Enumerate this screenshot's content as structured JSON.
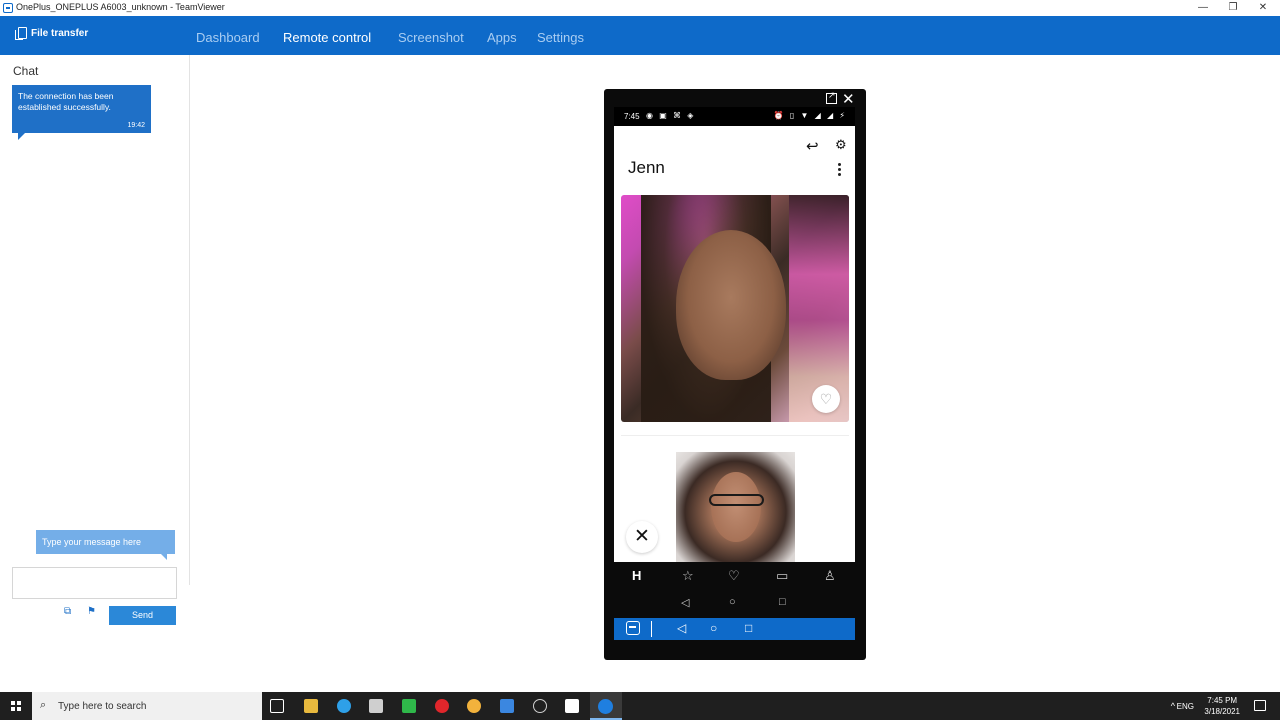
{
  "window": {
    "title": "OnePlus_ONEPLUS A6003_unknown - TeamViewer",
    "minimize_glyph": "—",
    "restore_glyph": "❐",
    "close_glyph": "✕"
  },
  "header": {
    "file_transfer_label": "File transfer",
    "tabs": [
      {
        "label": "Dashboard",
        "active": false
      },
      {
        "label": "Remote control",
        "active": true
      },
      {
        "label": "Screenshot",
        "active": false
      },
      {
        "label": "Apps",
        "active": false
      },
      {
        "label": "Settings",
        "active": false
      }
    ]
  },
  "chat": {
    "title": "Chat",
    "messages": [
      {
        "text": "The connection has been established successfully.",
        "time": "19:42"
      }
    ],
    "input_hint": "Type your message here",
    "input_value": "",
    "send_label": "Send"
  },
  "phone": {
    "status_time": "7:45",
    "status_icons_left": "◉ ▣ ⌘ ◈",
    "status_icons_right": "⏰ ▯ ▼ ◢ ◢ ⚡",
    "profile_name": "Jenn",
    "undo_glyph": "↩",
    "filter_glyph": "⚙",
    "like_glyph": "♡",
    "dismiss_glyph": "✕",
    "app_nav_icons": [
      "H",
      "☆",
      "♡",
      "▭",
      "♙"
    ],
    "system_nav": [
      "◁",
      "○",
      "□"
    ],
    "tv_nav": [
      "◁",
      "○",
      "□"
    ]
  },
  "taskbar": {
    "search_placeholder": "Type here to search",
    "language": "ENG",
    "time": "7:45 PM",
    "date": "3/18/2021",
    "app_icon_colors": [
      "#ffffff",
      "#e8b93e",
      "#2ea0e8",
      "#cfcfcf",
      "#2fb84a",
      "#e0262b",
      "#f2b23c",
      "#3b87e0",
      "#cfcfcf",
      "#ffffff",
      "#1f7fe0"
    ]
  }
}
